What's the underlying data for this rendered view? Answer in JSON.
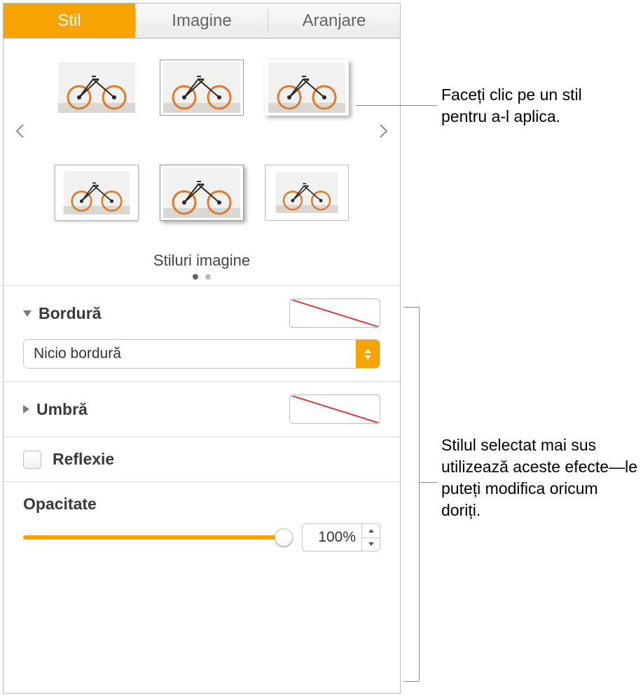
{
  "tabs": {
    "stil": "Stil",
    "imagine": "Imagine",
    "aranjare": "Aranjare"
  },
  "styles": {
    "caption": "Stiluri imagine"
  },
  "border": {
    "label": "Bordură",
    "dropdown": "Nicio bordură"
  },
  "shadow": {
    "label": "Umbră"
  },
  "reflect": {
    "label": "Reflexie"
  },
  "opacity": {
    "label": "Opacitate",
    "value": "100%"
  },
  "callouts": {
    "top": "Faceți clic pe un stil pentru a-l aplica.",
    "bottom": "Stilul selectat mai sus utilizează aceste efecte—le puteți modifica oricum doriți."
  }
}
